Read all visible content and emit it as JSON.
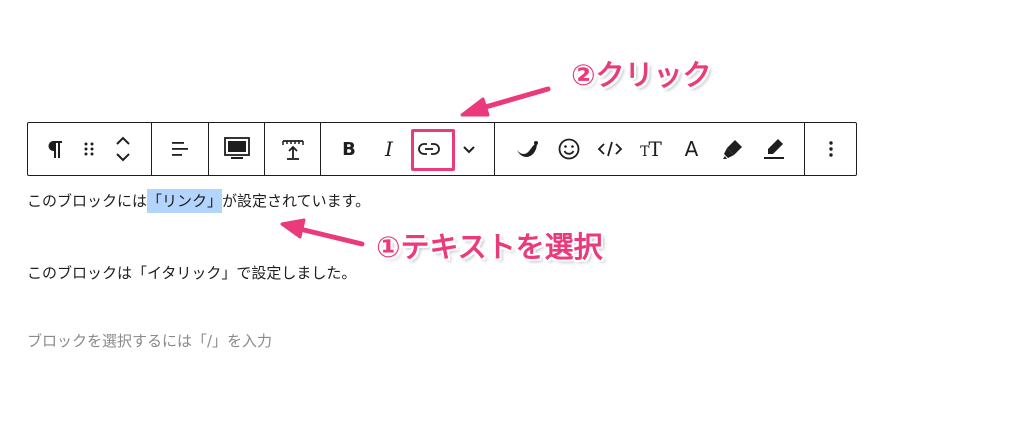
{
  "editor": {
    "paragraph1": {
      "before": "このブロックには",
      "selected": "「リンク」",
      "after": "が設定されています。"
    },
    "paragraph2": "このブロックは「イタリック」で設定しました。",
    "placeholder": "ブロックを選択するには「/」を入力"
  },
  "toolbar": {
    "bold_label": "B",
    "italic_label": "I",
    "text_size_label": "TT",
    "text_size_small": "T",
    "text_size_large": "T",
    "text_color_label": "A"
  },
  "annotations": {
    "click": "②クリック",
    "select_text": "①テキストを選択"
  },
  "colors": {
    "accent": "#ea3a7b",
    "selection": "#b3d4fc",
    "border": "#1e1e1e",
    "placeholder": "#8a8a8a"
  },
  "icons": [
    "paragraph-icon",
    "drag-handle-icon",
    "move-up-down-icon",
    "align-icon",
    "wide-width-icon",
    "height-icon",
    "link-icon",
    "chevron-down-icon",
    "brand-wave-icon",
    "emoji-icon",
    "code-icon",
    "text-size-icon",
    "text-color-icon",
    "highlighter-icon",
    "marker-icon",
    "more-options-icon"
  ]
}
